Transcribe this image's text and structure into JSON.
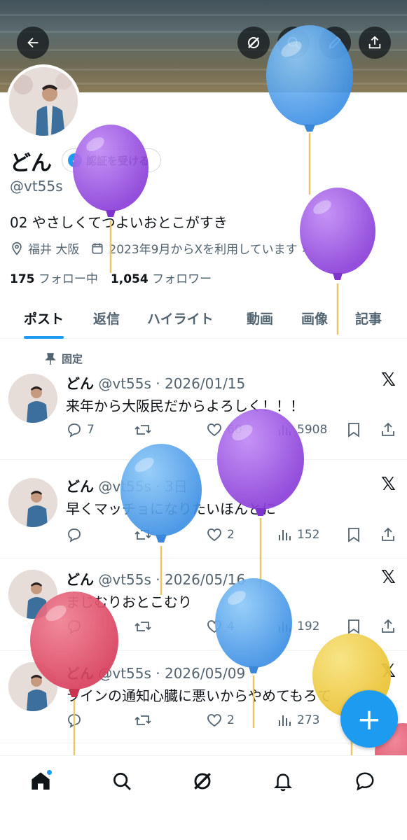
{
  "header": {
    "buttons": [
      {
        "name": "back-icon"
      },
      {
        "name": "grok-icon"
      },
      {
        "name": "search-icon"
      },
      {
        "name": "edit-icon"
      },
      {
        "name": "share-icon"
      }
    ]
  },
  "profile": {
    "name": "どん",
    "verify_label": "認証を受ける",
    "handle": "@vt55s",
    "bio": "02 やさしくてつよいおとこがすき",
    "location": "福井 大阪",
    "joined": "2023年9月からXを利用しています",
    "following_count": "175",
    "following_label": "フォロー中",
    "followers_count": "1,054",
    "followers_label": "フォロワー"
  },
  "tabs": [
    {
      "label": "ポスト",
      "active": true
    },
    {
      "label": "返信"
    },
    {
      "label": "ハイライト"
    },
    {
      "label": "動画"
    },
    {
      "label": "画像"
    },
    {
      "label": "記事"
    }
  ],
  "posts": [
    {
      "pinned_label": "固定",
      "name": "どん",
      "meta": "@vt55s · 2026/01/15",
      "text": "来年から大阪民だからよろしく！！！",
      "replies": "7",
      "retweets": "",
      "likes": "60",
      "views": "5908"
    },
    {
      "name": "どん",
      "meta": "@vt55s · 3日",
      "text": "早くマッチョになりたいほんとに",
      "replies": "",
      "retweets": "",
      "likes": "2",
      "views": "152"
    },
    {
      "name": "どん",
      "meta": "@vt55s · 2026/05/16",
      "text": "まじむりおとこむり",
      "replies": "",
      "retweets": "",
      "likes": "4",
      "views": "192"
    },
    {
      "name": "どん",
      "meta": "@vt55s · 2026/05/09",
      "text": "ラインの通知心臓に悪いからやめてもろて",
      "replies": "",
      "retweets": "",
      "likes": "2",
      "views": "273"
    }
  ],
  "fab": {
    "label": "+"
  },
  "nav": [
    {
      "name": "home-icon",
      "badge": true
    },
    {
      "name": "search-icon"
    },
    {
      "name": "grok-icon"
    },
    {
      "name": "notifications-icon"
    },
    {
      "name": "messages-icon"
    }
  ],
  "colors": {
    "accent": "#1d9bf0",
    "text": "#0f1419",
    "muted": "#536471",
    "balloon_purple": "#9b4fe0",
    "balloon_blue": "#5aa9f0",
    "balloon_red": "#e2506a",
    "balloon_yellow": "#f2cf4a"
  }
}
